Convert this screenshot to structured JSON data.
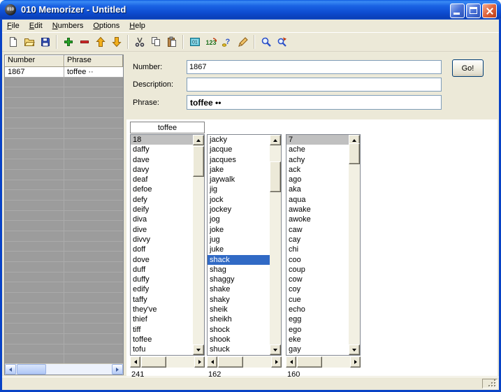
{
  "window": {
    "title": "010 Memorizer - Untitled",
    "controls": [
      "minimize",
      "maximize",
      "close"
    ]
  },
  "menu": {
    "items": [
      "File",
      "Edit",
      "Numbers",
      "Options",
      "Help"
    ]
  },
  "toolbar": {
    "items": [
      "new-document",
      "open-folder",
      "save",
      "separator",
      "add-number",
      "remove-number",
      "move-up",
      "move-down",
      "separator",
      "cut",
      "copy",
      "paste",
      "separator",
      "number-image",
      "renumber",
      "quiz",
      "edit-pencil",
      "separator",
      "search",
      "search-next"
    ]
  },
  "table": {
    "columns": [
      "Number",
      "Phrase"
    ],
    "rows": [
      {
        "number": "1867",
        "phrase": "toffee ··"
      }
    ],
    "empty_rows": 28
  },
  "form": {
    "number_label": "Number:",
    "number_value": "1867",
    "go_button": "Go!",
    "description_label": "Description:",
    "description_value": "",
    "phrase_label": "Phrase:",
    "phrase_value": "toffee ••"
  },
  "lists": [
    {
      "header": "toffee",
      "count": "241",
      "selected_index": 0,
      "selection": "inactive",
      "items": [
        "18",
        "daffy",
        "dave",
        "davy",
        "deaf",
        "defoe",
        "defy",
        "deify",
        "diva",
        "dive",
        "divvy",
        "doff",
        "dove",
        "duff",
        "duffy",
        "edify",
        "taffy",
        "they've",
        "thief",
        "tiff",
        "toffee",
        "tofu"
      ]
    },
    {
      "header": "",
      "count": "162",
      "selected_index": 12,
      "selection": "active",
      "items": [
        "jacky",
        "jacque",
        "jacques",
        "jake",
        "jaywalk",
        "jig",
        "jock",
        "jockey",
        "jog",
        "joke",
        "jug",
        "juke",
        "shack",
        "shag",
        "shaggy",
        "shake",
        "shaky",
        "sheik",
        "sheikh",
        "shock",
        "shook",
        "shuck"
      ]
    },
    {
      "header": "",
      "count": "160",
      "selected_index": 0,
      "selection": "inactive",
      "items": [
        "7",
        "ache",
        "achy",
        "ack",
        "ago",
        "aka",
        "aqua",
        "awake",
        "awoke",
        "caw",
        "cay",
        "chi",
        "coo",
        "coup",
        "cow",
        "coy",
        "cue",
        "echo",
        "egg",
        "ego",
        "eke",
        "gay"
      ]
    }
  ],
  "colors": {
    "titlebar_top": "#3A8BF4",
    "titlebar_bottom": "#0A3FB8",
    "frame": "#0842C6",
    "window_bg": "#ECE9D8",
    "selection_active": "#316AC5",
    "selection_inactive": "#C0C0C0"
  }
}
